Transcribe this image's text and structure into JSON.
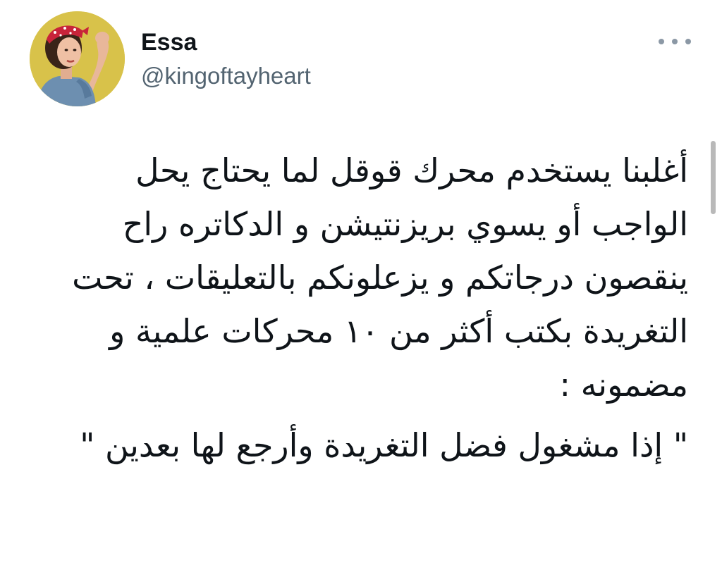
{
  "tweet": {
    "author_name": "Essa",
    "author_handle": "@kingoftayheart",
    "avatar_icon": "profile-photo",
    "more_icon": "more-options-icon",
    "text_paragraphs": [
      "أغلبنا يستخدم محرك قوقل لما يحتاج يحل الواجب أو يسوي بريزنتيشن و الدكاتره راح ينقصون درجاتكم و يزعلونكم بالتعليقات ، تحت التغريدة بكتب أكثر من ١٠ محركات علمية و مضمونه :",
      "\" إذا مشغول فضل التغريدة وأرجع لها بعدين \""
    ]
  },
  "colors": {
    "text": "#0f1419",
    "secondary_text": "#536471",
    "avatar_bg": "#d8c24a",
    "bandana": "#c8243a"
  }
}
